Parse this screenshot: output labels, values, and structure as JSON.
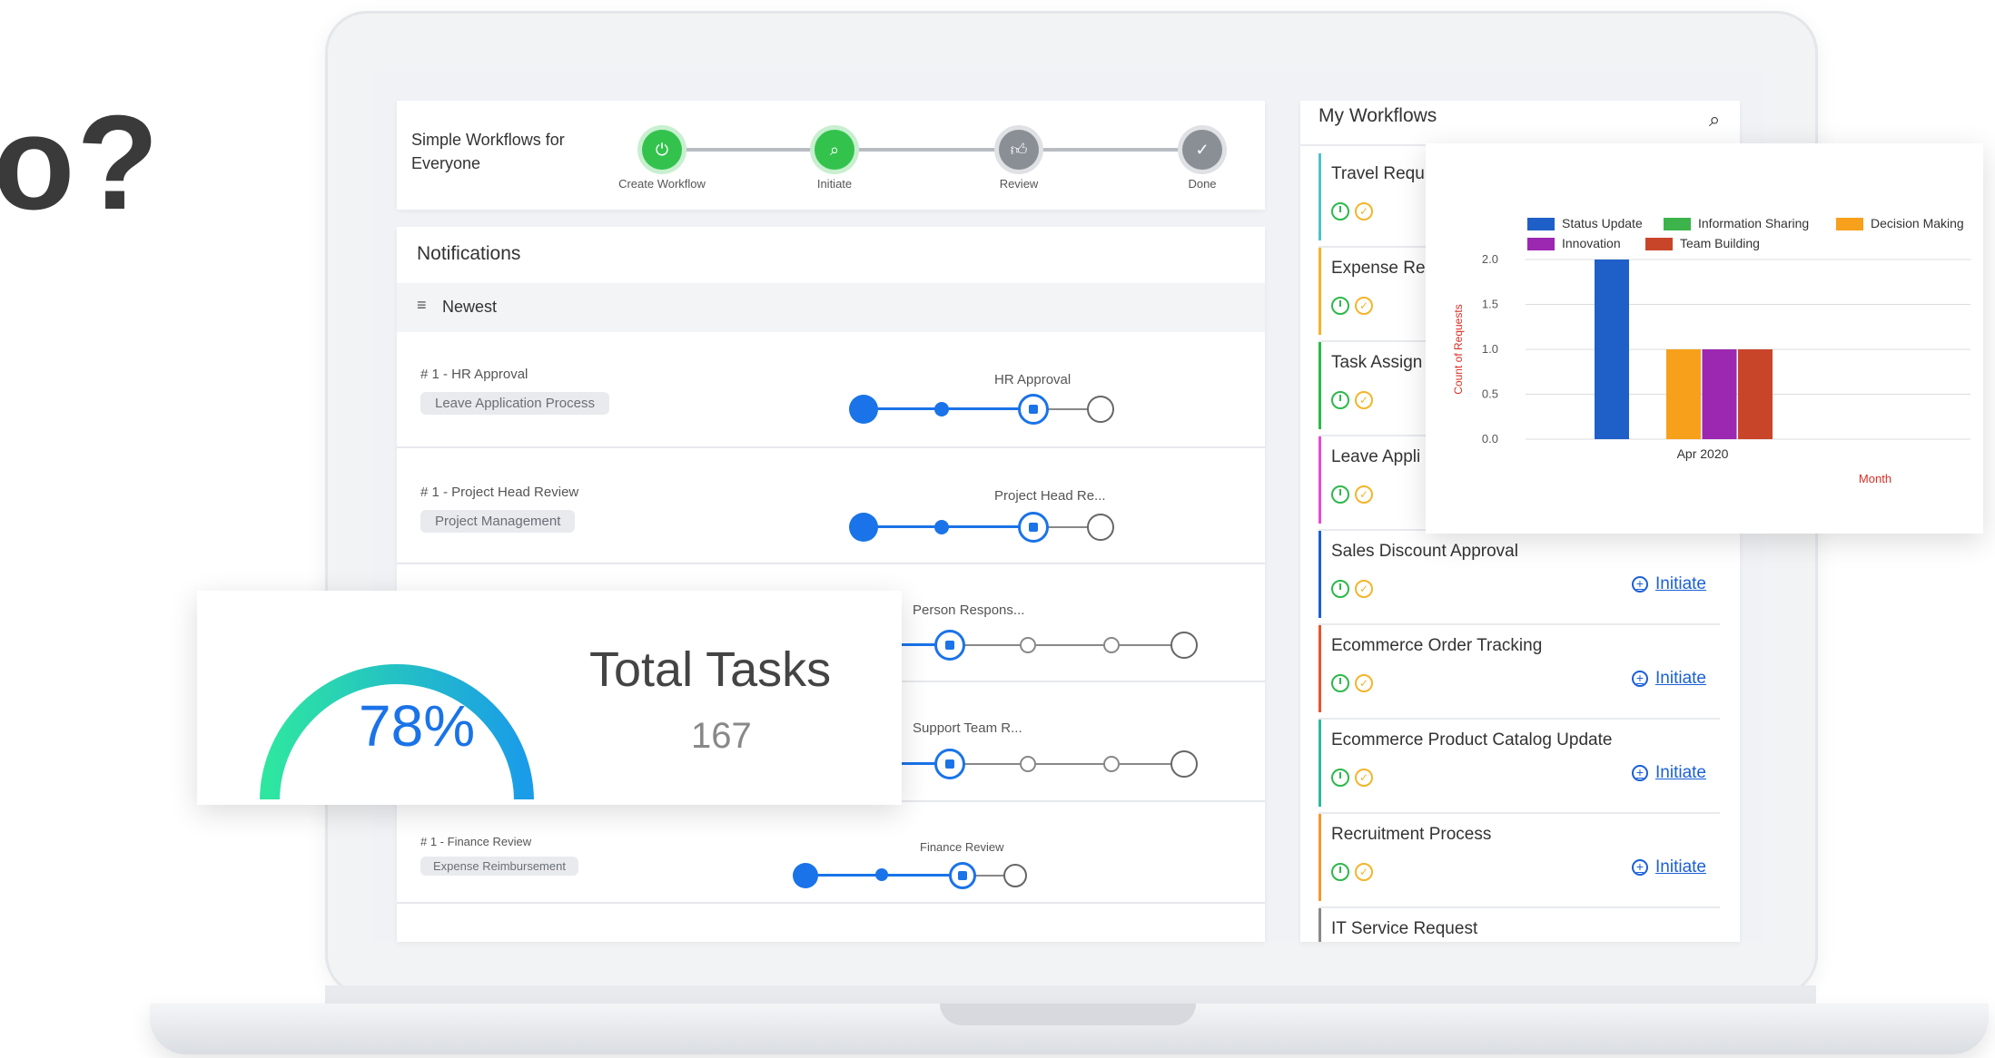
{
  "headline": "o?",
  "colors": {
    "primary": "#1a73e8",
    "step_active": "#33c34d",
    "step_inactive": "#8a8f96",
    "clock": "#2db84c",
    "check": "#f3b52b",
    "link": "#1a5fd6"
  },
  "stepper": {
    "title": "Simple Workflows for Everyone",
    "steps": [
      {
        "label": "Create Workflow",
        "state": "active",
        "icon": "power-icon"
      },
      {
        "label": "Initiate",
        "state": "active",
        "icon": "search-icon"
      },
      {
        "label": "Review",
        "state": "inactive",
        "icon": "thumbs-up-icon"
      },
      {
        "label": "Done",
        "state": "inactive",
        "icon": "check-icon"
      }
    ]
  },
  "notifications": {
    "title": "Notifications",
    "sort_label": "Newest",
    "rows": [
      {
        "title": "# 1 - HR Approval",
        "tag": "Leave Application Process",
        "stage": "HR Approval"
      },
      {
        "title": "# 1 - Project Head Review",
        "tag": "Project Management",
        "stage": "Project Head Re..."
      },
      {
        "title": "",
        "tag": "",
        "stage": "Person Respons..."
      },
      {
        "title": "",
        "tag": "",
        "stage": "Support Team R..."
      },
      {
        "title": "# 1 - Finance Review",
        "tag": "Expense Reimbursement",
        "stage": "Finance Review"
      }
    ]
  },
  "total_tasks": {
    "percent_label": "78%",
    "percent_value": 0.78,
    "title": "Total Tasks",
    "count": "167"
  },
  "workflows": {
    "title": "My Workflows",
    "initiate_label": "Initiate",
    "items": [
      {
        "name": "Travel Requ",
        "color": "#4dc3c8",
        "initiate": false
      },
      {
        "name": "Expense Re",
        "color": "#f3b52b",
        "initiate": false
      },
      {
        "name": "Task Assign",
        "color": "#2db84c",
        "initiate": false
      },
      {
        "name": "Leave Appli",
        "color": "#e84bd0",
        "initiate": false
      },
      {
        "name": "Sales Discount Approval",
        "color": "#1a5fd6",
        "initiate": true
      },
      {
        "name": "Ecommerce Order Tracking",
        "color": "#e8542b",
        "initiate": true
      },
      {
        "name": "Ecommerce Product Catalog Update",
        "color": "#2db8a0",
        "initiate": true
      },
      {
        "name": "Recruitment Process",
        "color": "#f39a2b",
        "initiate": true
      },
      {
        "name": "IT Service Request",
        "color": "#888888",
        "initiate": false
      }
    ]
  },
  "chart_data": {
    "type": "bar",
    "categories": [
      "Apr 2020"
    ],
    "series": [
      {
        "name": "Status Update",
        "color": "#1f5fc8",
        "values": [
          2.0
        ]
      },
      {
        "name": "Information Sharing",
        "color": "#3cb44b",
        "values": [
          0
        ]
      },
      {
        "name": "Decision Making",
        "color": "#f7a01b",
        "values": [
          1.0
        ]
      },
      {
        "name": "Innovation",
        "color": "#9c27b0",
        "values": [
          1.0
        ]
      },
      {
        "name": "Team Building",
        "color": "#c9452a",
        "values": [
          1.0
        ]
      }
    ],
    "yticks": [
      "0.0",
      "0.5",
      "1.0",
      "1.5",
      "2.0"
    ],
    "ylim": [
      0,
      2.0
    ],
    "ylabel": "Count of Requests",
    "xlabel": "Month",
    "legend": "top",
    "grid": true
  }
}
